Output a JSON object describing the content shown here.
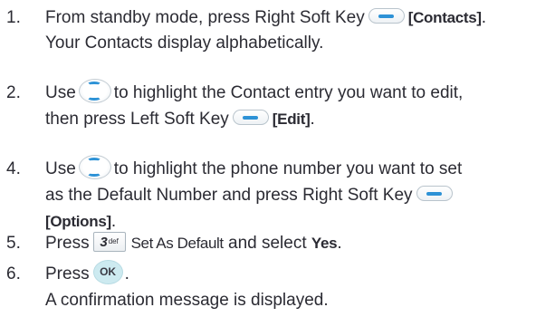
{
  "steps": [
    {
      "number": "1.",
      "line1_pre": "From standby mode, press Right Soft Key",
      "line1_bold": "[Contacts]",
      "line1_post": ".",
      "line2": "Your Contacts display alphabetically."
    },
    {
      "number": "2.",
      "line1_pre": "Use",
      "line1_post": "to highlight the Contact entry you want to edit,",
      "line2_pre": "then press Left Soft Key",
      "line2_bold": "[Edit]",
      "line2_post": "."
    },
    {
      "number": "4.",
      "line1_pre": "Use",
      "line1_post": "to highlight the phone number you want to set",
      "line2_pre": "as the Default Number and press Right Soft Key",
      "line3_bold": "[Options]",
      "line3_post": "."
    },
    {
      "number": "5.",
      "pre": "Press",
      "key_digit": "3",
      "key_letters": "def",
      "option_text": "Set As Default",
      "mid": "and select",
      "bold": "Yes",
      "post": "."
    },
    {
      "number": "6.",
      "pre": "Press",
      "ok_label": "OK",
      "post": ".",
      "line2": "A confirmation message is displayed."
    }
  ],
  "icons": {
    "right_soft_key": "right-soft-key-icon",
    "left_soft_key": "left-soft-key-icon",
    "navigation_key": "navigation-key-icon",
    "key_3": "key-3-icon",
    "ok_key": "ok-key-icon"
  },
  "colors": {
    "text": "#2b2b33",
    "softkey_accent": "#2d92d6",
    "ok_fill": "#cdeaf0"
  }
}
